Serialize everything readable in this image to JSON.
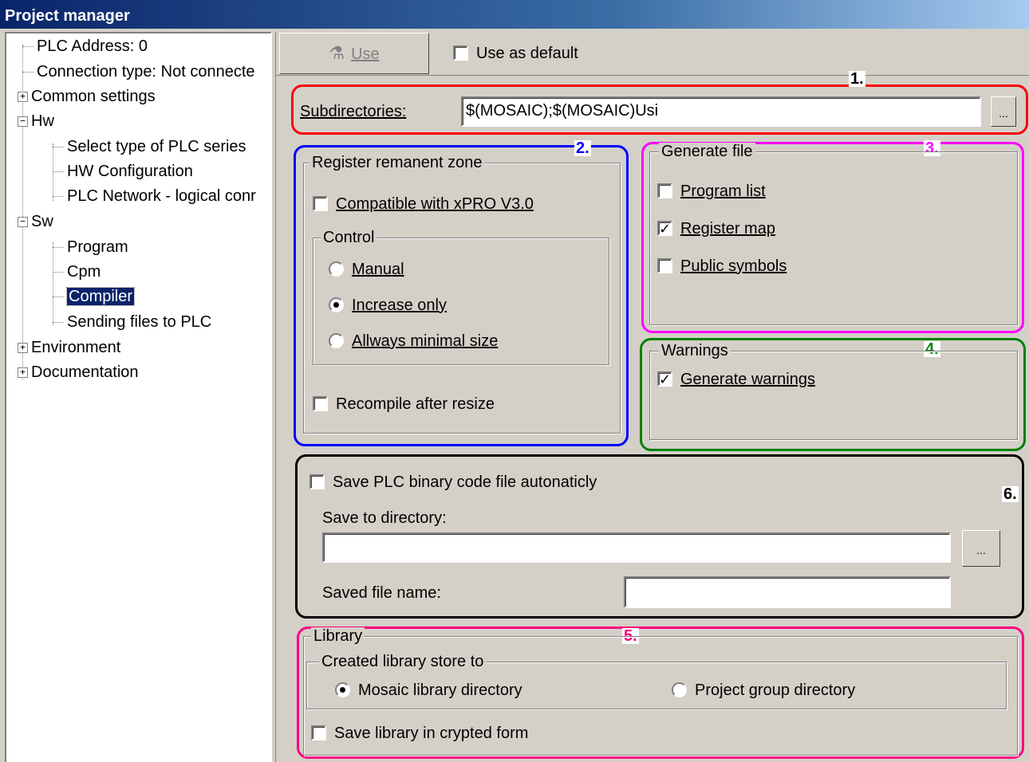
{
  "window": {
    "title": "Project manager"
  },
  "tree": {
    "items": [
      {
        "label": "PLC Address: 0"
      },
      {
        "label": "Connection type: Not connecte"
      },
      {
        "label": "Common settings",
        "expander": "+"
      },
      {
        "label": "Hw",
        "expander": "−"
      },
      {
        "label": "Select type of PLC series"
      },
      {
        "label": "HW Configuration"
      },
      {
        "label": "PLC Network - logical conr"
      },
      {
        "label": "Sw",
        "expander": "−"
      },
      {
        "label": "Program"
      },
      {
        "label": "Cpm"
      },
      {
        "label": "Compiler",
        "selected": true
      },
      {
        "label": "Sending files to PLC"
      },
      {
        "label": "Environment",
        "expander": "+"
      },
      {
        "label": "Documentation",
        "expander": "+"
      }
    ]
  },
  "toolbar": {
    "use_button": "Use",
    "use_as_default": {
      "label": "Use as default",
      "checked": false
    }
  },
  "annotations": {
    "n1": "1.",
    "n2": "2.",
    "n3": "3.",
    "n4": "4.",
    "n5": "5.",
    "n6": "6.",
    "colors": {
      "n1": "#ff0000",
      "n2": "#0000ff",
      "n3": "#ff00ff",
      "n4": "#008000",
      "n5": "#ff0080",
      "n6": "#000000"
    }
  },
  "subdirectories": {
    "label": "Subdirectories:",
    "value": "$(MOSAIC);$(MOSAIC)Usi",
    "browse": "..."
  },
  "register_zone": {
    "title": "Register remanent zone",
    "compatible": {
      "label": "Compatible with xPRO V3.0",
      "checked": false
    },
    "control": {
      "title": "Control",
      "options": [
        {
          "label": "Manual",
          "selected": false
        },
        {
          "label": "Increase only",
          "selected": true
        },
        {
          "label": "Allways minimal size",
          "selected": false
        }
      ]
    },
    "recompile": {
      "label": "Recompile after resize",
      "checked": false
    }
  },
  "generate_file": {
    "title": "Generate file",
    "program_list": {
      "label": "Program list",
      "checked": false
    },
    "register_map": {
      "label": "Register map",
      "checked": true
    },
    "public_symbols": {
      "label": "Public symbols",
      "checked": false
    }
  },
  "warnings": {
    "title": "Warnings",
    "generate": {
      "label": "Generate warnings",
      "checked": true
    }
  },
  "binary": {
    "save_auto": {
      "label": "Save PLC binary code file autonaticly",
      "checked": false
    },
    "dir_label": "Save to directory:",
    "dir_value": "",
    "browse": "...",
    "file_label": "Saved file name:",
    "file_value": ""
  },
  "library": {
    "title": "Library",
    "store": {
      "title": "Created library store to",
      "options": [
        {
          "label": "Mosaic library directory",
          "selected": true
        },
        {
          "label": "Project group directory",
          "selected": false
        }
      ]
    },
    "crypted": {
      "label": "Save library in crypted form",
      "checked": false
    }
  }
}
